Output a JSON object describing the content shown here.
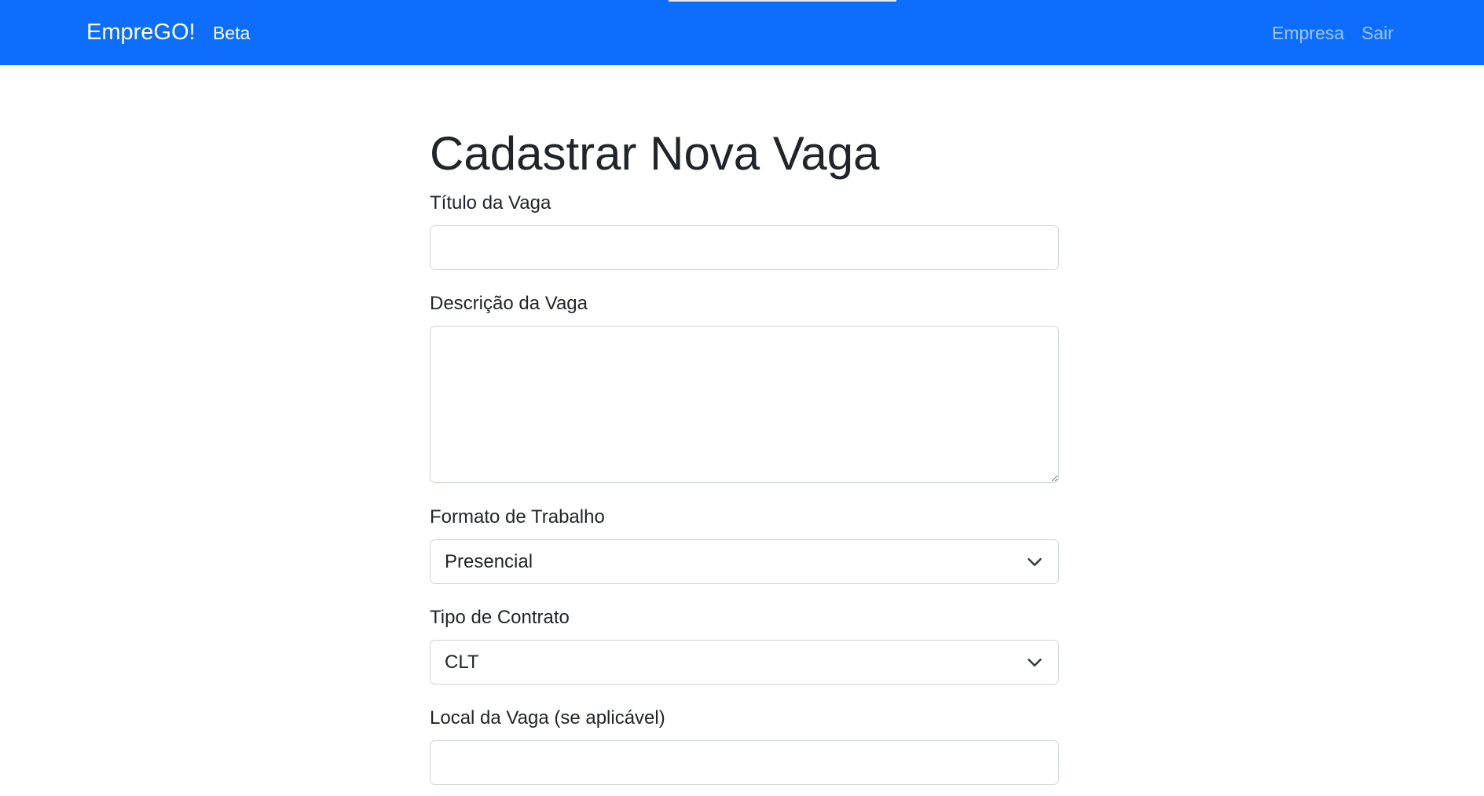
{
  "navbar": {
    "brand": "EmpreGO!",
    "beta": "Beta",
    "links": [
      "Empresa",
      "Sair"
    ]
  },
  "page": {
    "title": "Cadastrar Nova Vaga"
  },
  "form": {
    "titulo_label": "Título da Vaga",
    "titulo_value": "",
    "descricao_label": "Descrição da Vaga",
    "descricao_value": "",
    "formato_label": "Formato de Trabalho",
    "formato_value": "Presencial",
    "contrato_label": "Tipo de Contrato",
    "contrato_value": "CLT",
    "local_label": "Local da Vaga (se aplicável)",
    "local_value": ""
  },
  "colors": {
    "navbar": "#0d6efd",
    "nav_link_muted": "rgba(255,255,255,0.6)",
    "input_border": "#ced4da"
  },
  "icons": {
    "select_arrow": "chevron-down-icon"
  }
}
